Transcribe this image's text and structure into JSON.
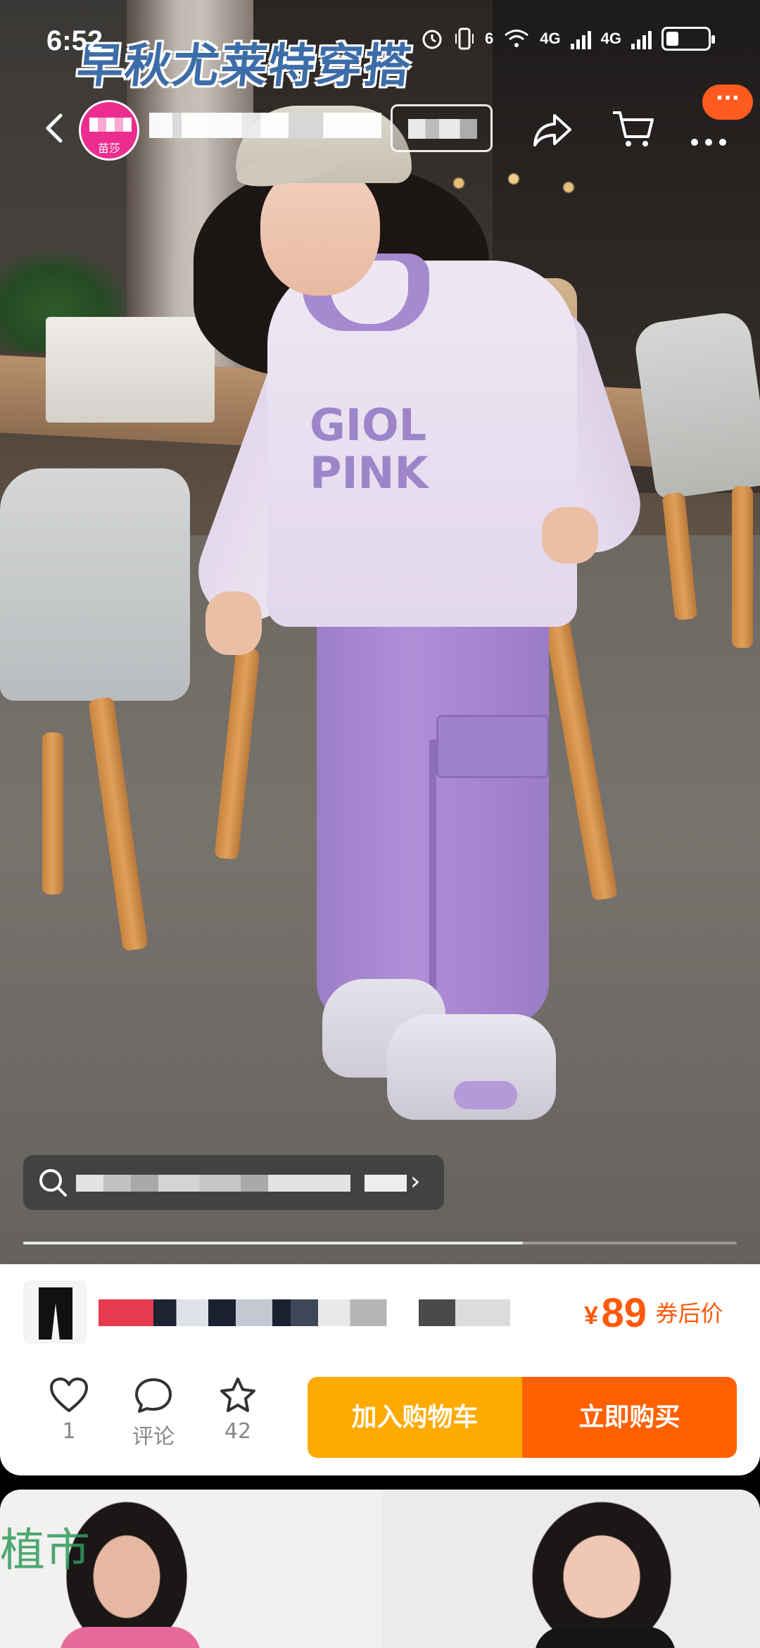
{
  "status_bar": {
    "time": "6:52",
    "network_1": "4G",
    "network_2": "4G",
    "wifi_label": "6",
    "battery_level": 0.3
  },
  "video": {
    "title_overlay": "早秋尤莱特穿搭",
    "print_text_line1": "GIOL",
    "print_text_line2": "PINK",
    "progress": 0.7
  },
  "nav": {
    "avatar_label": "苗莎",
    "more_badge": "···"
  },
  "product": {
    "price_symbol": "¥",
    "price": "89",
    "price_note": "券后价"
  },
  "actions": {
    "like_count": "1",
    "comment_label": "评论",
    "favorite_count": "42"
  },
  "cta": {
    "add_to_cart": "加入购物车",
    "buy_now": "立即购买"
  },
  "feed": {
    "watermark": "植市"
  },
  "colors": {
    "accent_orange": "#ff6100",
    "cart_yellow": "#ffaa00",
    "price_orange": "#ff5a0a",
    "avatar_pink": "#ec2c8e"
  },
  "icons": [
    "back-icon",
    "share-icon",
    "cart-icon",
    "more-icon",
    "search-icon",
    "chevron-right-icon",
    "heart-icon",
    "comment-icon",
    "star-icon"
  ]
}
